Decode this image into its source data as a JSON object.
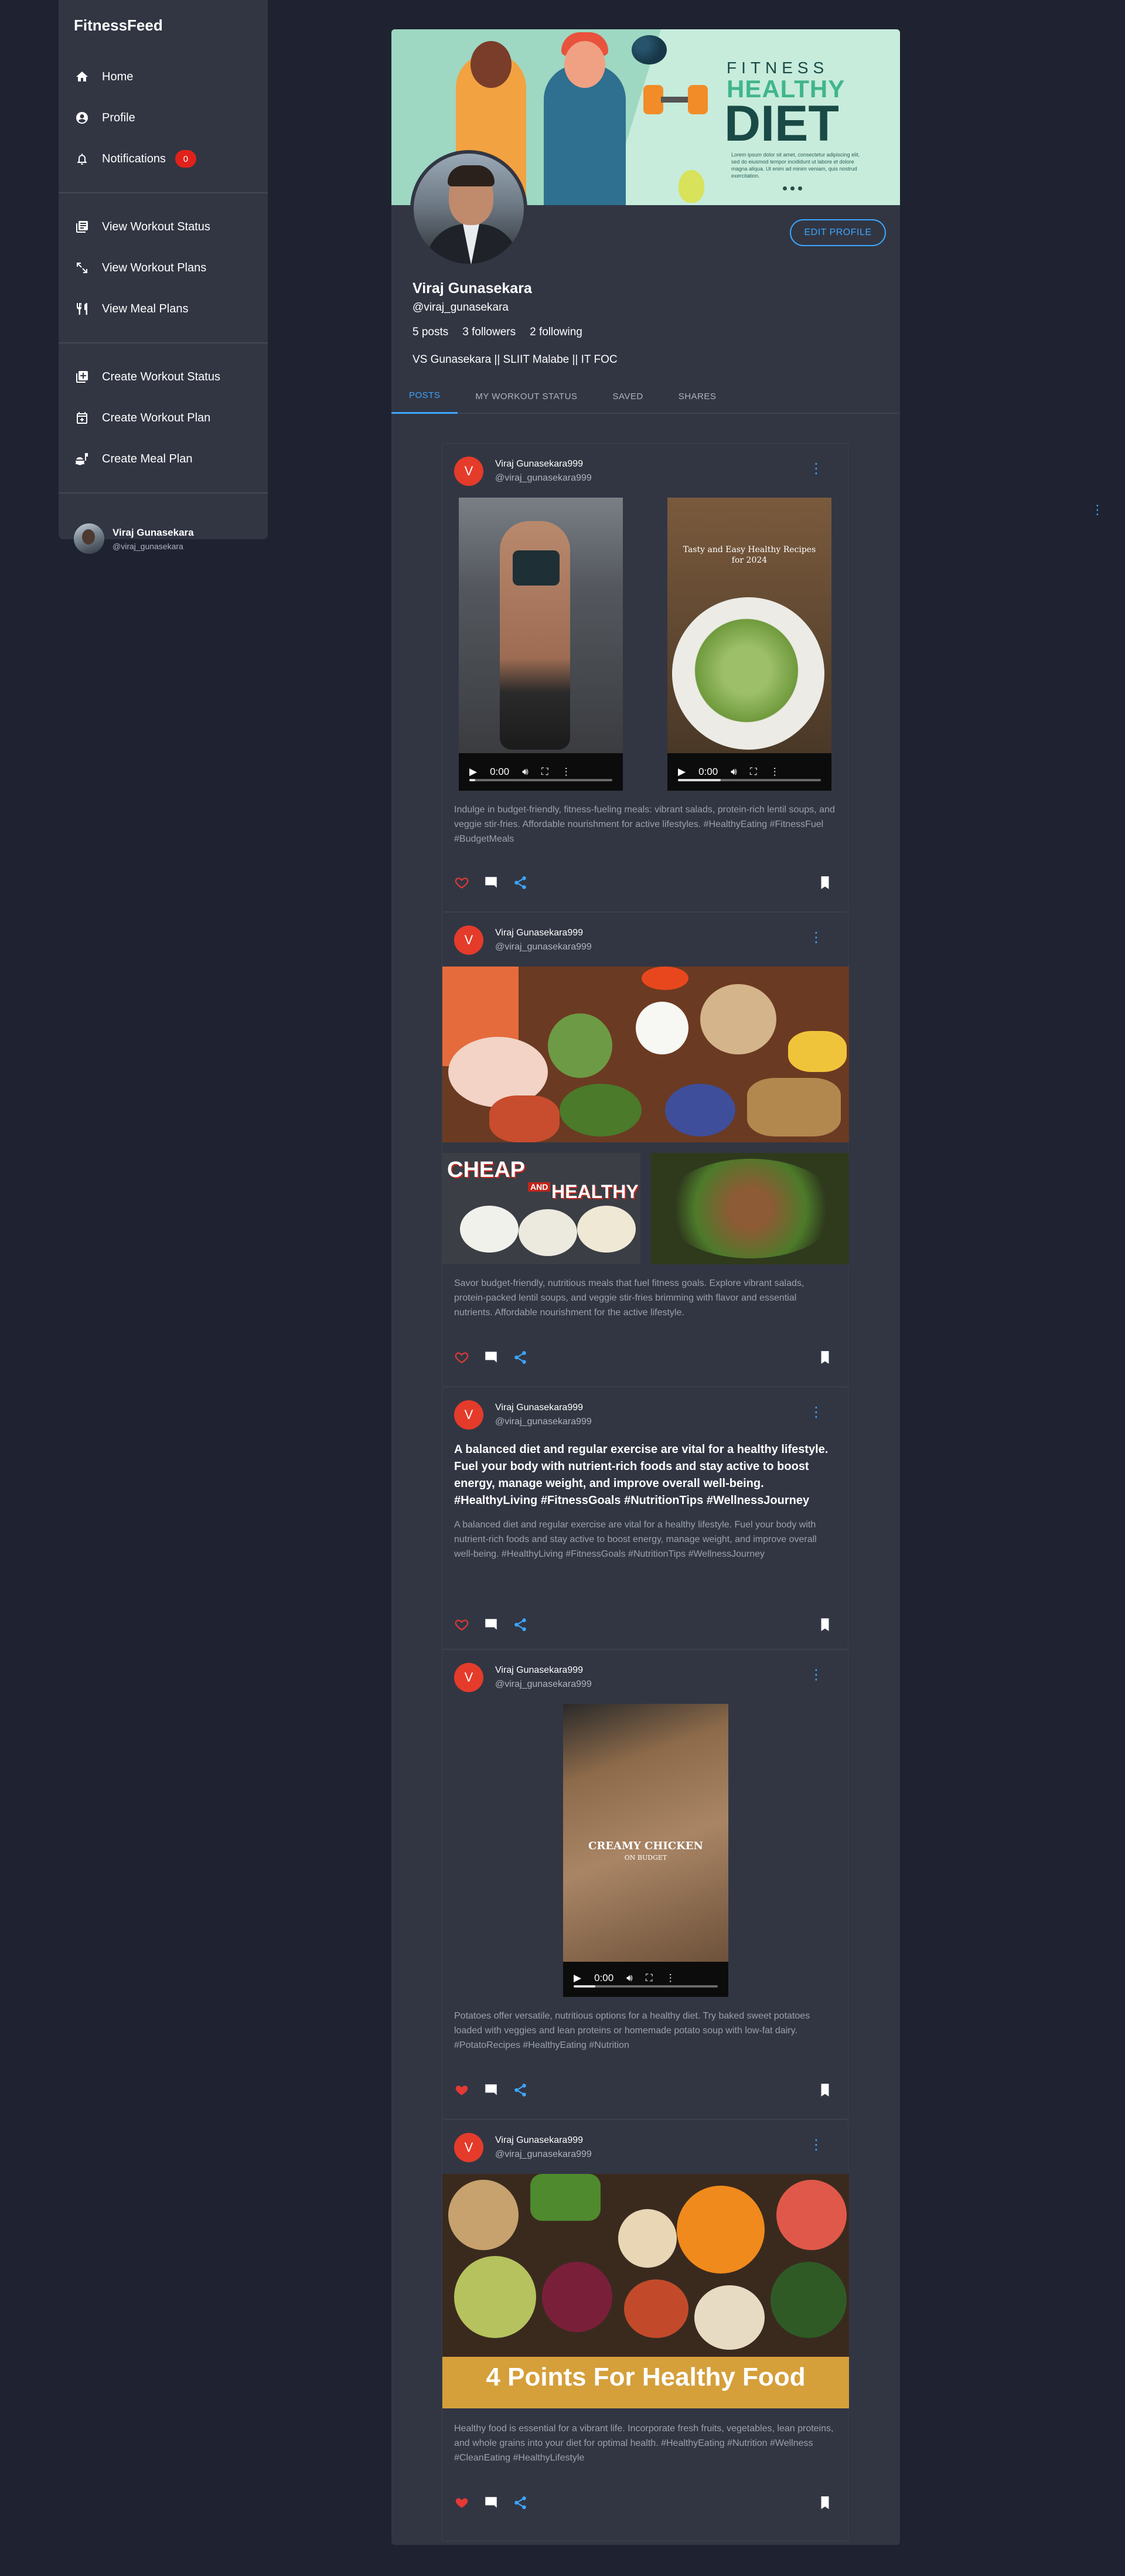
{
  "app": {
    "brand": "FitnessFeed"
  },
  "sidebar": {
    "items": [
      {
        "label": "Home",
        "icon": "home-icon"
      },
      {
        "label": "Profile",
        "icon": "account-circle-icon"
      },
      {
        "label": "Notifications",
        "icon": "bell-icon",
        "badge": "0"
      },
      {
        "label": "View Workout Status",
        "icon": "library-icon"
      },
      {
        "label": "View Workout Plans",
        "icon": "expand-arrows-icon"
      },
      {
        "label": "View Meal Plans",
        "icon": "fork-knife-icon"
      },
      {
        "label": "Create Workout Status",
        "icon": "library-add-icon"
      },
      {
        "label": "Create Workout Plan",
        "icon": "calendar-add-icon"
      },
      {
        "label": "Create Meal Plan",
        "icon": "meal-bowl-icon"
      }
    ],
    "user": {
      "name": "Viraj Gunasekara",
      "handle": "@viraj_gunasekara"
    }
  },
  "cover": {
    "line1": "FITNESS",
    "line2": "HEALTHY",
    "line3": "DIET",
    "small_text": "Lorem ipsum dolor sit amet, consectetur adipiscing elit, sed do eiusmod tempor incididunt ut labore et dolore magna aliqua. Ut enim ad minim veniam, quis nostrud exercitation."
  },
  "profile": {
    "name": "Viraj Gunasekara",
    "handle": "@viraj_gunasekara",
    "posts": "5 posts",
    "followers": "3 followers",
    "following": "2 following",
    "bio": "VS Gunasekara || SLIIT Malabe || IT FOC",
    "edit_label": "EDIT PROFILE"
  },
  "tabs": [
    {
      "label": "POSTS",
      "active": true
    },
    {
      "label": "MY WORKOUT STATUS",
      "active": false
    },
    {
      "label": "SAVED",
      "active": false
    },
    {
      "label": "SHARES",
      "active": false
    }
  ],
  "posts": [
    {
      "author": "Viraj Gunasekara999",
      "handle": "@viraj_gunasekara999",
      "avatar_letter": "V",
      "video_time_1": "0:00",
      "video_time_2": "0:00",
      "video2_caption": "Tasty and Easy Healthy Recipes for 2024",
      "text": "Indulge in budget-friendly, fitness-fueling meals: vibrant salads, protein-rich lentil soups, and veggie stir-fries. Affordable nourishment for active lifestyles. #HealthyEating #FitnessFuel #BudgetMeals",
      "liked": false
    },
    {
      "author": "Viraj Gunasekara999",
      "handle": "@viraj_gunasekara999",
      "avatar_letter": "V",
      "img_text_1": "CHEAP",
      "img_text_2": "AND",
      "img_text_3": "HEALTHY",
      "text": "Savor budget-friendly, nutritious meals that fuel fitness goals. Explore vibrant salads, protein-packed lentil soups, and veggie stir-fries brimming with flavor and essential nutrients. Affordable nourishment for the active lifestyle.",
      "liked": false
    },
    {
      "author": "Viraj Gunasekara999",
      "handle": "@viraj_gunasekara999",
      "avatar_letter": "V",
      "bold": "A balanced diet and regular exercise are vital for a healthy lifestyle. Fuel your body with nutrient-rich foods and stay active to boost energy, manage weight, and improve overall well-being. #HealthyLiving #FitnessGoals #NutritionTips #WellnessJourney",
      "text": "A balanced diet and regular exercise are vital for a healthy lifestyle. Fuel your body with nutrient-rich foods and stay active to boost energy, manage weight, and improve overall well-being. #HealthyLiving #FitnessGoals #NutritionTips #WellnessJourney",
      "liked": false
    },
    {
      "author": "Viraj Gunasekara999",
      "handle": "@viraj_gunasekara999",
      "avatar_letter": "V",
      "video_time": "0:00",
      "video_title": "CREAMY CHICKEN",
      "video_subtitle": "ON BUDGET",
      "text": "Potatoes offer versatile, nutritious options for a healthy diet. Try baked sweet potatoes loaded with veggies and lean proteins or homemade potato soup with low-fat dairy. #PotatoRecipes #HealthyEating #Nutrition",
      "liked": true
    },
    {
      "author": "Viraj Gunasekara999",
      "handle": "@viraj_gunasekara999",
      "avatar_letter": "V",
      "banner": "4 Points For Healthy Food",
      "text": "Healthy food is essential for a vibrant life. Incorporate fresh fruits, vegetables, lean proteins, and whole grains into your diet for optimal health. #HealthyEating #Nutrition #Wellness #CleanEating #HealthyLifestyle",
      "liked": true
    }
  ],
  "colors": {
    "accent": "#3ea6ff",
    "like": "#e53935",
    "badge": "#e0221b",
    "panel": "#323643",
    "background": "#1f2230"
  }
}
